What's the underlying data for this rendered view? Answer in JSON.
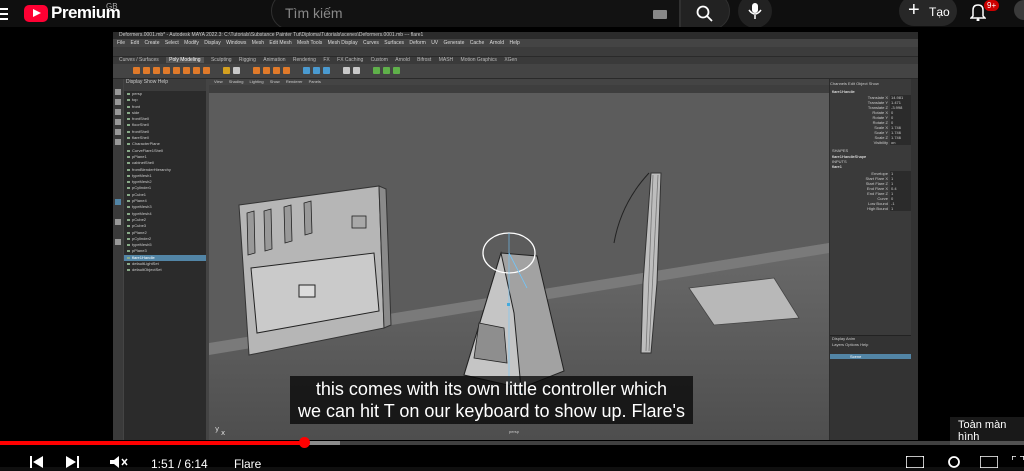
{
  "header": {
    "logo_text": "Premium",
    "region": "GB",
    "search_placeholder": "Tìm kiếm",
    "create_label": "Tạo",
    "notification_count": "9+"
  },
  "maya": {
    "window_title": "Deformers.0001.mb* - Autodesk MAYA 2022.3: C:\\Tutorials\\Substance Painter Tut\\Diploma\\Tutorials\\scenes\\Deformers.0001.mb  ---  flare1",
    "menus": [
      "File",
      "Edit",
      "Create",
      "Select",
      "Modify",
      "Display",
      "Windows",
      "Mesh",
      "Edit Mesh",
      "Mesh Tools",
      "Mesh Display",
      "Curves",
      "Surfaces",
      "Deform",
      "UV",
      "Generate",
      "Cache",
      "Arnold",
      "Help"
    ],
    "shelf_tabs": [
      "Curves / Surfaces",
      "Poly Modeling",
      "Sculpting",
      "Rigging",
      "Animation",
      "Rendering",
      "FX",
      "FX Caching",
      "Custom",
      "Arnold",
      "Bifrost",
      "MASH",
      "Motion Graphics",
      "XGen"
    ],
    "active_shelf_tab": "Poly Modeling",
    "outliner_menus": [
      "Display",
      "Show",
      "Help"
    ],
    "outliner_items": [
      "persp",
      "top",
      "front",
      "side",
      "frontShell",
      "floorShell",
      "frontShell",
      "flareShell",
      "CharacterPlane",
      "CurveFlare1Shell",
      "pPlane1",
      "cabinetShell",
      "fromBlenderHierarchy",
      "typeMesh1",
      "typeMesh2",
      "pCylinder1",
      "pCube1",
      "pPlane4",
      "typeMesh3",
      "typeMesh4",
      "pCube2",
      "pCube3",
      "pPlane2",
      "pCylinder2",
      "typeMesh5",
      "pPlane3",
      "flare1Handle",
      "defaultLightSet",
      "defaultObjectSet"
    ],
    "selected_item": "flare1Handle",
    "viewport_menus": [
      "View",
      "Shading",
      "Lighting",
      "Show",
      "Renderer",
      "Panels"
    ],
    "camera_label": "persp",
    "channel_tabs": [
      "Channels",
      "Edit",
      "Object",
      "Show"
    ],
    "channel_object": "flare1Handle",
    "channels": [
      {
        "name": "Translate X",
        "value": "14.981"
      },
      {
        "name": "Translate Y",
        "value": "1.471"
      },
      {
        "name": "Translate Z",
        "value": "-3.998"
      },
      {
        "name": "Rotate X",
        "value": "0"
      },
      {
        "name": "Rotate Y",
        "value": "0"
      },
      {
        "name": "Rotate Z",
        "value": "0"
      },
      {
        "name": "Scale X",
        "value": "1.746"
      },
      {
        "name": "Scale Y",
        "value": "1.746"
      },
      {
        "name": "Scale Z",
        "value": "1.746"
      },
      {
        "name": "Visibility",
        "value": "on"
      }
    ],
    "shapes_label": "SHAPES",
    "shape_name": "flare1HandleShape",
    "inputs_label": "INPUTS",
    "input_name": "flare1",
    "input_channels": [
      {
        "name": "Envelope",
        "value": "1"
      },
      {
        "name": "Start Flare X",
        "value": "1"
      },
      {
        "name": "Start Flare Z",
        "value": "1"
      },
      {
        "name": "End Flare X",
        "value": "0.4"
      },
      {
        "name": "End Flare Z",
        "value": "1"
      },
      {
        "name": "Curve",
        "value": "0"
      },
      {
        "name": "Low Bound",
        "value": "-1"
      },
      {
        "name": "High Bound",
        "value": "1"
      }
    ],
    "layer_tabs": [
      "Display",
      "Anim"
    ],
    "layer_menus": [
      "Layers",
      "Options",
      "Help"
    ],
    "layer_name": "Scene"
  },
  "subtitles": [
    "this comes with its own little controller which",
    "we can hit T on our keyboard to show up. Flare's"
  ],
  "tooltip": "Toàn màn hình",
  "player": {
    "time": "1:51 / 6:14",
    "chapter": "Flare",
    "progress_fraction": 0.297
  }
}
